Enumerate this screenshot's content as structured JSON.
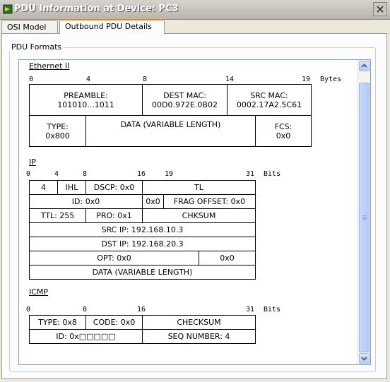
{
  "window": {
    "title": "PDU Information at Device: PC3"
  },
  "tabs": [
    {
      "label": "OSI Model",
      "active": false
    },
    {
      "label": "Outbound PDU Details",
      "active": true
    }
  ],
  "group": {
    "label": "PDU Formats"
  },
  "ethernet": {
    "title": "Ethernet II",
    "ruler": [
      "0",
      "4",
      "8",
      "14",
      "19",
      "Bytes"
    ],
    "preamble_label": "PREAMBLE:",
    "preamble_value": "101010...1011",
    "dest_label": "DEST MAC:",
    "dest_value": "00D0.972E.0B02",
    "src_label": "SRC MAC:",
    "src_value": "0002.17A2.5C61",
    "type_label": "TYPE:",
    "type_value": "0x800",
    "data_label": "DATA (VARIABLE LENGTH)",
    "fcs_label": "FCS:",
    "fcs_value": "0x0"
  },
  "ip": {
    "title": "IP",
    "ruler": [
      "0",
      "4",
      "8",
      "16",
      "19",
      "31",
      "Bits"
    ],
    "version": "4",
    "ihl": "IHL",
    "dscp": "DSCP: 0x0",
    "tl": "TL",
    "id": "ID: 0x0",
    "flags": "0x0",
    "frag_offset": "FRAG OFFSET: 0x0",
    "ttl": "TTL: 255",
    "pro": "PRO: 0x1",
    "chksum": "CHKSUM",
    "src_ip": "SRC IP: 192.168.10.3",
    "dst_ip": "DST IP: 192.168.20.3",
    "opt": "OPT: 0x0",
    "opt_pad": "0x0",
    "data": "DATA (VARIABLE LENGTH)"
  },
  "icmp": {
    "title": "ICMP",
    "ruler": [
      "0",
      "8",
      "16",
      "31",
      "Bits"
    ],
    "type": "TYPE: 0x8",
    "code": "CODE: 0x0",
    "checksum": "CHECKSUM",
    "id": "ID: 0x□□□□□",
    "seq": "SEQ NUMBER: 4"
  }
}
